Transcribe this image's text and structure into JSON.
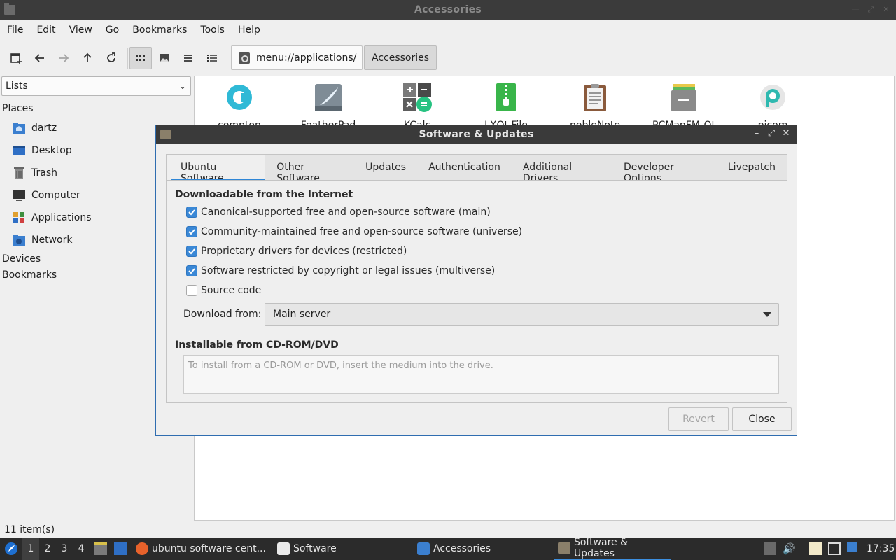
{
  "window": {
    "title": "Accessories"
  },
  "menu": [
    "File",
    "Edit",
    "View",
    "Go",
    "Bookmarks",
    "Tools",
    "Help"
  ],
  "toolbar": {
    "path": "menu://applications/",
    "crumb": "Accessories",
    "icons": [
      "new-tab-icon",
      "back-icon",
      "forward-icon",
      "up-icon",
      "reload-icon",
      "icon-view-icon",
      "thumbnail-view-icon",
      "compact-view-icon",
      "detailed-list-icon"
    ]
  },
  "sidebar": {
    "mode": "Lists",
    "places_header": "Places",
    "places": [
      "dartz",
      "Desktop",
      "Trash",
      "Computer",
      "Applications",
      "Network"
    ],
    "devices_header": "Devices",
    "bookmarks_header": "Bookmarks"
  },
  "status": "11 item(s)",
  "apps": [
    "compton",
    "FeatherPad",
    "KCalc",
    "LXQt File",
    "nobleNote",
    "PCManFM-Qt",
    "picom"
  ],
  "dialog": {
    "title": "Software & Updates",
    "tabs": [
      "Ubuntu Software",
      "Other Software",
      "Updates",
      "Authentication",
      "Additional Drivers",
      "Developer Options",
      "Livepatch"
    ],
    "section_internet": "Downloadable from the Internet",
    "options": [
      {
        "label": "Canonical-supported free and open-source software (main)",
        "checked": true
      },
      {
        "label": "Community-maintained free and open-source software (universe)",
        "checked": true
      },
      {
        "label": "Proprietary drivers for devices (restricted)",
        "checked": true
      },
      {
        "label": "Software restricted by copyright or legal issues (multiverse)",
        "checked": true
      },
      {
        "label": "Source code",
        "checked": false
      }
    ],
    "download_from_label": "Download from:",
    "download_from_value": "Main server",
    "section_cdrom": "Installable from CD-ROM/DVD",
    "cdrom_text": "To install from a CD-ROM or DVD, insert the medium into the drive.",
    "revert": "Revert",
    "close": "Close"
  },
  "taskbar": {
    "workspaces": [
      "1",
      "2",
      "3",
      "4"
    ],
    "tasks": [
      "ubuntu software cent...",
      "Software",
      "Accessories",
      "Software & Updates"
    ],
    "clock": "17:35"
  }
}
